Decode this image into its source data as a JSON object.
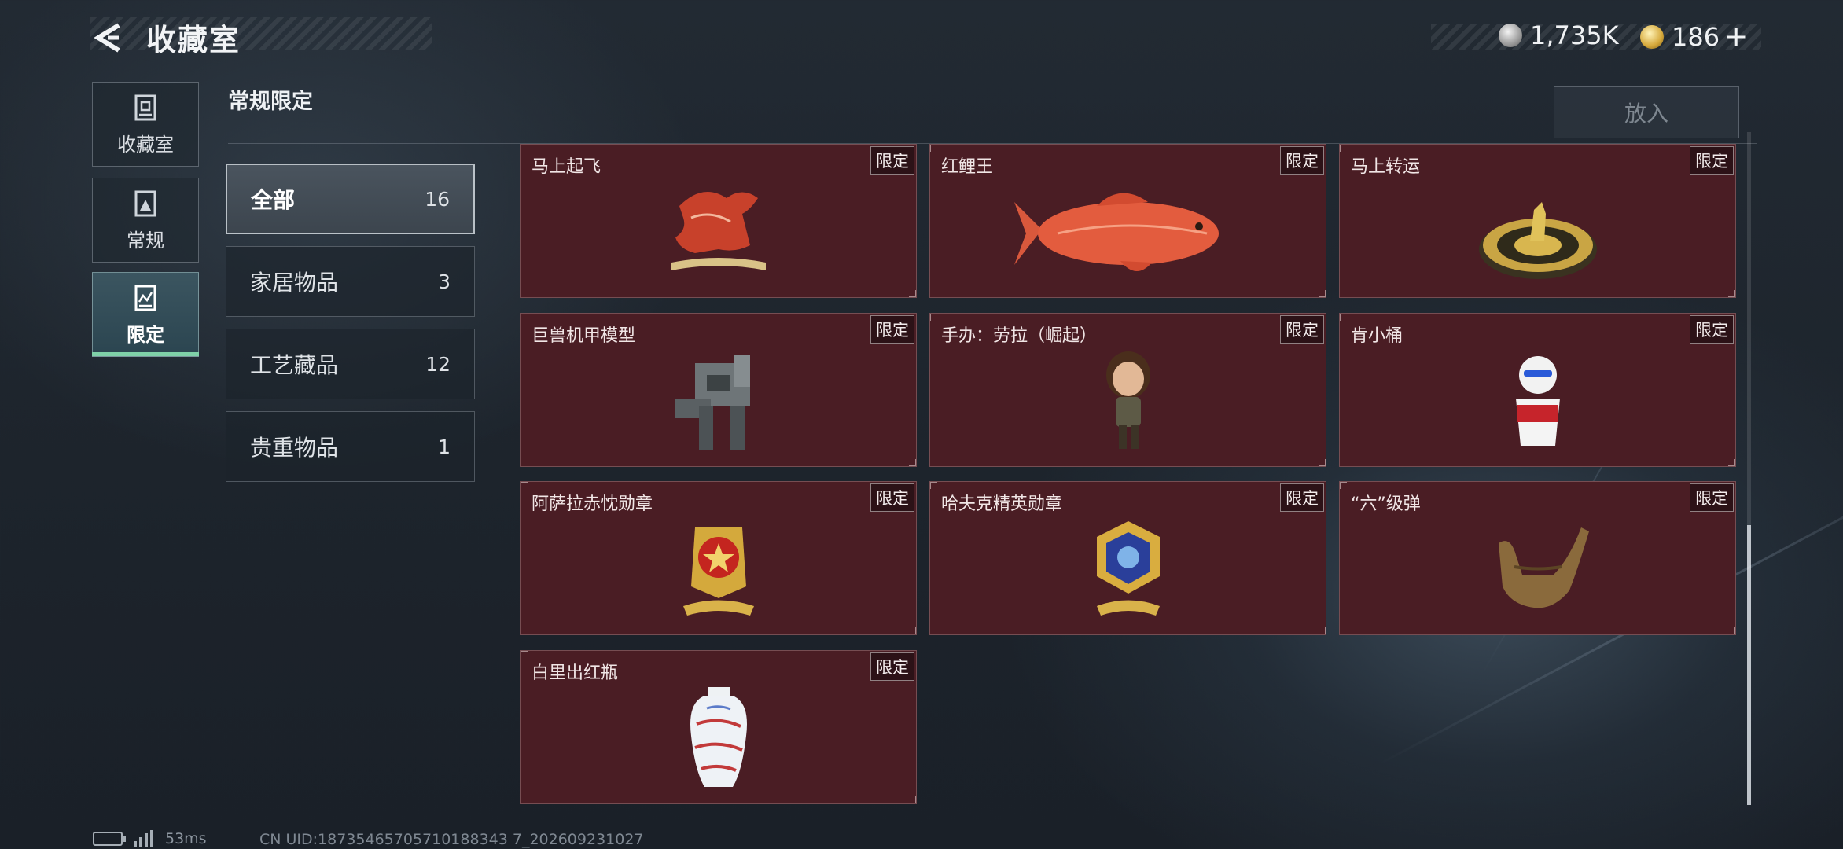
{
  "header": {
    "title": "收藏室",
    "currencies": [
      {
        "icon": "silver-coin-icon",
        "value": "1,735K"
      },
      {
        "icon": "gold-coin-icon",
        "value": "186"
      }
    ],
    "plus_label": "+"
  },
  "nav": {
    "items": [
      {
        "label": "收藏室",
        "icon": "collection-room-icon",
        "active": false
      },
      {
        "label": "常规",
        "icon": "regular-icon",
        "active": false
      },
      {
        "label": "限定",
        "icon": "limited-icon",
        "active": true
      }
    ]
  },
  "section": {
    "title": "常规限定"
  },
  "put_in_label": "放入",
  "categories": [
    {
      "label": "全部",
      "count": "16",
      "active": true
    },
    {
      "label": "家居物品",
      "count": "3",
      "active": false
    },
    {
      "label": "工艺藏品",
      "count": "12",
      "active": false
    },
    {
      "label": "贵重物品",
      "count": "1",
      "active": false
    }
  ],
  "badge_label": "限定",
  "items": [
    {
      "name": "马上起飞",
      "icon": "flying-horse-figurine-icon"
    },
    {
      "name": "红鲤王",
      "icon": "red-carp-icon"
    },
    {
      "name": "马上转运",
      "icon": "golden-wheel-icon"
    },
    {
      "name": "巨兽机甲模型",
      "icon": "mech-model-icon"
    },
    {
      "name": "手办：劳拉（崛起）",
      "icon": "lara-figure-icon"
    },
    {
      "name": "肯小桶",
      "icon": "bucket-mascot-icon"
    },
    {
      "name": "阿萨拉赤忱勋章",
      "icon": "red-medal-icon"
    },
    {
      "name": "哈夫克精英勋章",
      "icon": "blue-medal-icon"
    },
    {
      "name": "“六”级弹",
      "icon": "hand-sign-sculpture-icon"
    },
    {
      "name": "白里出红瓶",
      "icon": "porcelain-vase-icon"
    }
  ],
  "footer": {
    "ping": "53ms",
    "uid": "CN UID:18735465705710188343 7_202609231027"
  },
  "colors": {
    "card_bg": "#4a1d24",
    "accent_underline": "#7fd1a8"
  }
}
